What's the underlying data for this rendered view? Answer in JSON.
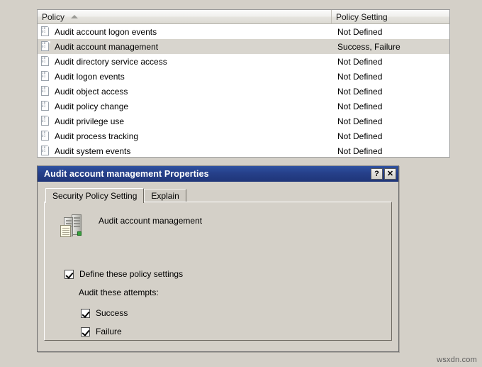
{
  "list_view": {
    "columns": [
      {
        "id": "policy",
        "label": "Policy",
        "sorted": true,
        "sort_direction": "ascending",
        "sort_icon": "sort-ascending-arrow-icon"
      },
      {
        "id": "policy_setting",
        "label": "Policy Setting",
        "sorted": false
      }
    ],
    "rows": [
      {
        "icon": "policy-document-icon",
        "policy": "Audit account logon events",
        "setting": "Not Defined",
        "selected": false
      },
      {
        "icon": "policy-document-icon",
        "policy": "Audit account management",
        "setting": "Success, Failure",
        "selected": true
      },
      {
        "icon": "policy-document-icon",
        "policy": "Audit directory service access",
        "setting": "Not Defined",
        "selected": false
      },
      {
        "icon": "policy-document-icon",
        "policy": "Audit logon events",
        "setting": "Not Defined",
        "selected": false
      },
      {
        "icon": "policy-document-icon",
        "policy": "Audit object access",
        "setting": "Not Defined",
        "selected": false
      },
      {
        "icon": "policy-document-icon",
        "policy": "Audit policy change",
        "setting": "Not Defined",
        "selected": false
      },
      {
        "icon": "policy-document-icon",
        "policy": "Audit privilege use",
        "setting": "Not Defined",
        "selected": false
      },
      {
        "icon": "policy-document-icon",
        "policy": "Audit process tracking",
        "setting": "Not Defined",
        "selected": false
      },
      {
        "icon": "policy-document-icon",
        "policy": "Audit system events",
        "setting": "Not Defined",
        "selected": false
      }
    ]
  },
  "dialog": {
    "title": "Audit account management Properties",
    "help_button_label": "?",
    "close_button_label": "✕",
    "tabs": [
      {
        "id": "security-policy-setting",
        "label": "Security Policy Setting",
        "active": true
      },
      {
        "id": "explain",
        "label": "Explain",
        "active": false
      }
    ],
    "policy_name": "Audit account management",
    "policy_icon": "server-policy-icon",
    "define_checkbox": {
      "label": "Define these policy settings",
      "checked": true
    },
    "attempts_label": "Audit these attempts:",
    "attempts": [
      {
        "id": "success",
        "label": "Success",
        "checked": true
      },
      {
        "id": "failure",
        "label": "Failure",
        "checked": true
      }
    ]
  },
  "watermark": "wsxdn.com",
  "colors": {
    "titlebar_start": "#2e51a0",
    "titlebar_end": "#1f3578",
    "dialog_face": "#d4d0c8",
    "selection": "#d8d5ce",
    "list_background": "#ffffff"
  }
}
